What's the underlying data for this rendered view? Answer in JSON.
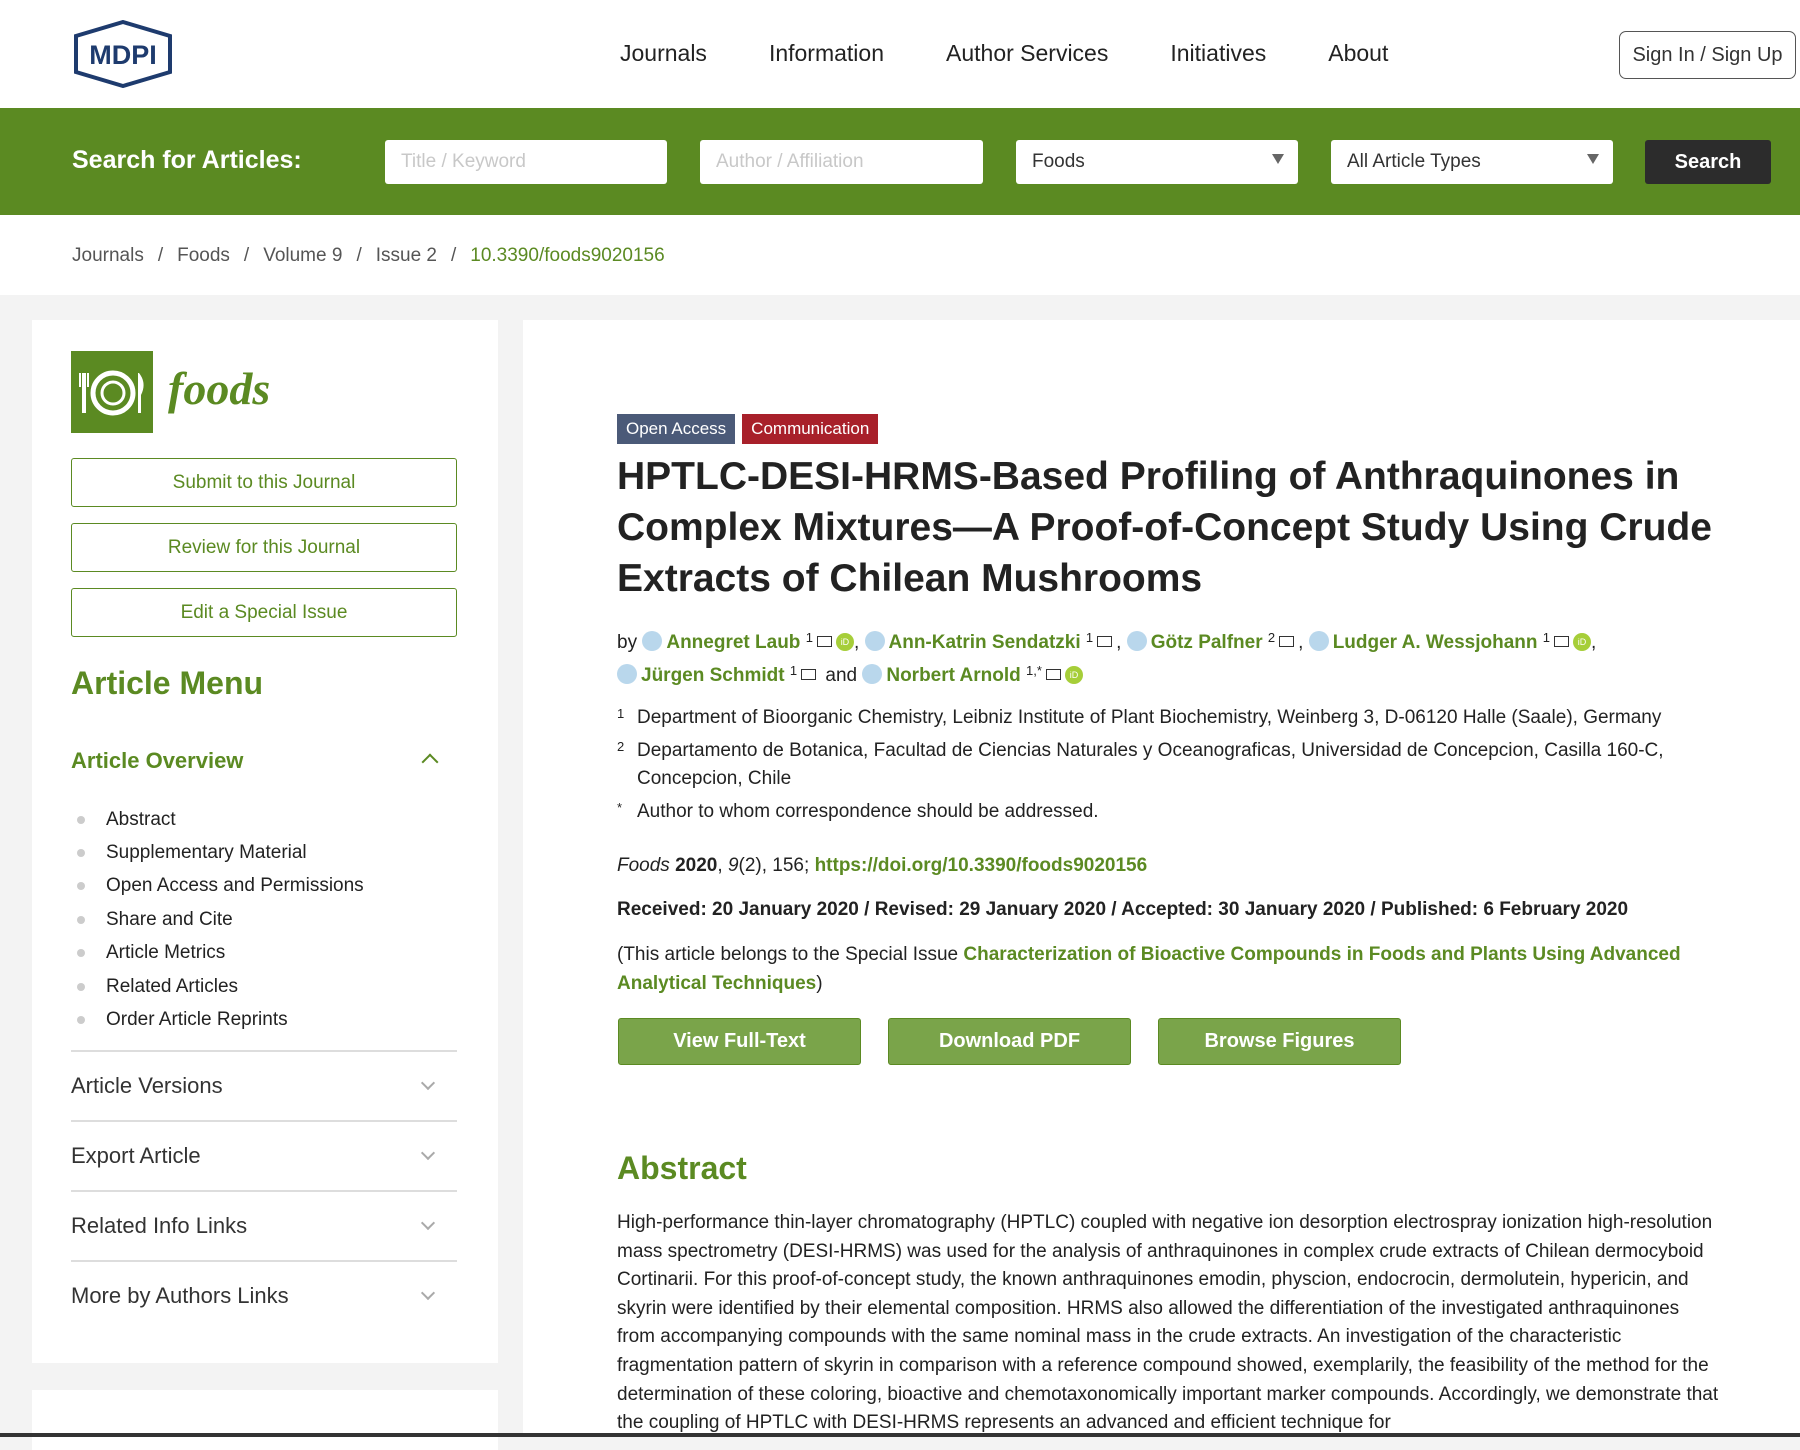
{
  "header": {
    "logo_text": "MDPI",
    "nav": [
      "Journals",
      "Information",
      "Author Services",
      "Initiatives",
      "About"
    ],
    "signin": "Sign In / Sign Up"
  },
  "search": {
    "label": "Search for Articles:",
    "title_placeholder": "Title / Keyword",
    "author_placeholder": "Author / Affiliation",
    "journal_value": "Foods",
    "type_value": "All Article Types",
    "button": "Search"
  },
  "breadcrumb": [
    "Journals",
    "Foods",
    "Volume 9",
    "Issue 2",
    "10.3390/foods9020156"
  ],
  "sidebar": {
    "journal_name": "foods",
    "buttons": [
      "Submit to this Journal",
      "Review for this Journal",
      "Edit a Special Issue"
    ],
    "menu_title": "Article Menu",
    "overview_title": "Article Overview",
    "overview_items": [
      "Abstract",
      "Supplementary Material",
      "Open Access and Permissions",
      "Share and Cite",
      "Article Metrics",
      "Related Articles",
      "Order Article Reprints"
    ],
    "sections": [
      "Article Versions",
      "Export Article",
      "Related Info Links",
      "More by Authors Links"
    ]
  },
  "article": {
    "badge_access": "Open Access",
    "badge_type": "Communication",
    "title": "HPTLC-DESI-HRMS-Based Profiling of Anthraquinones in Complex Mixtures—A Proof-of-Concept Study Using Crude Extracts of Chilean Mushrooms",
    "by": "by",
    "and": "and",
    "authors": [
      {
        "name": "Annegret Laub",
        "aff": "1"
      },
      {
        "name": "Ann-Katrin Sendatzki",
        "aff": "1"
      },
      {
        "name": "Götz Palfner",
        "aff": "2"
      },
      {
        "name": "Ludger A. Wessjohann",
        "aff": "1"
      },
      {
        "name": "Jürgen Schmidt",
        "aff": "1"
      },
      {
        "name": "Norbert Arnold",
        "aff": "1,*"
      }
    ],
    "orcid_label": "iD",
    "affiliations": [
      {
        "n": "1",
        "text": "Department of Bioorganic Chemistry, Leibniz Institute of Plant Biochemistry, Weinberg 3, D-06120 Halle (Saale), Germany"
      },
      {
        "n": "2",
        "text": "Departamento de Botanica, Facultad de Ciencias Naturales y Oceanograficas, Universidad de Concepcion, Casilla 160-C, Concepcion, Chile"
      },
      {
        "n": "*",
        "text": "Author to whom correspondence should be addressed."
      }
    ],
    "cite_journal": "Foods",
    "cite_year": "2020",
    "cite_volume": "9",
    "cite_rest": "(2), 156;",
    "doi_link": "https://doi.org/10.3390/foods9020156",
    "dates": "Received: 20 January 2020 / Revised: 29 January 2020 / Accepted: 30 January 2020 / Published: 6 February 2020",
    "special_prefix": "(This article belongs to the Special Issue",
    "special_link": "Characterization of Bioactive Compounds in Foods and Plants Using Advanced Analytical Techniques",
    "special_suffix": ")",
    "actions": [
      "View Full-Text",
      "Download PDF",
      "Browse Figures"
    ],
    "abstract_title": "Abstract",
    "abstract_text": "High-performance thin-layer chromatography (HPTLC) coupled with negative ion desorption electrospray ionization high-resolution mass spectrometry (DESI-HRMS) was used for the analysis of anthraquinones in complex crude extracts of Chilean dermocyboid Cortinarii. For this proof-of-concept study, the known anthraquinones emodin, physcion, endocrocin, dermolutein, hypericin, and skyrin were identified by their elemental composition. HRMS also allowed the differentiation of the investigated anthraquinones from accompanying compounds with the same nominal mass in the crude extracts. An investigation of the characteristic fragmentation pattern of skyrin in comparison with a reference compound showed, exemplarily, the feasibility of the method for the determination of these coloring, bioactive and chemotaxonomically important marker compounds. Accordingly, we demonstrate that the coupling of HPTLC with DESI-HRMS represents an advanced and efficient technique for"
  },
  "colors": {
    "brand_green": "#5b8a22",
    "open_access": "#4b5a78",
    "communication": "#a8202a"
  }
}
